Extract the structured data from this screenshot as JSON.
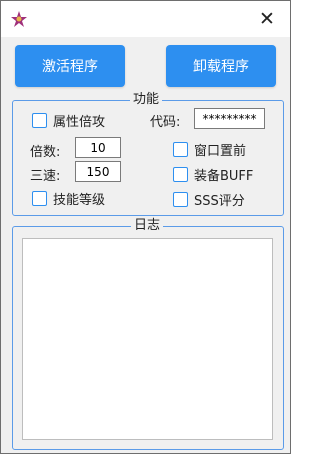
{
  "window": {
    "close_glyph": "✕"
  },
  "buttons": {
    "activate": "激活程序",
    "uninstall": "卸载程序"
  },
  "features": {
    "title": "功能",
    "attribute_multiplier": "属性倍攻",
    "code_label": "代码:",
    "code_value": "*********",
    "multiplier_label": "倍数:",
    "multiplier_value": "10",
    "triple_speed_label": "三速:",
    "triple_speed_value": "150",
    "skill_level": "技能等级",
    "window_top": "窗口置前",
    "equip_buff": "装备BUFF",
    "sss_score": "SSS评分"
  },
  "log": {
    "title": "日志"
  },
  "colors": {
    "accent": "#2d8ff0",
    "group_border": "#5b9be8"
  }
}
